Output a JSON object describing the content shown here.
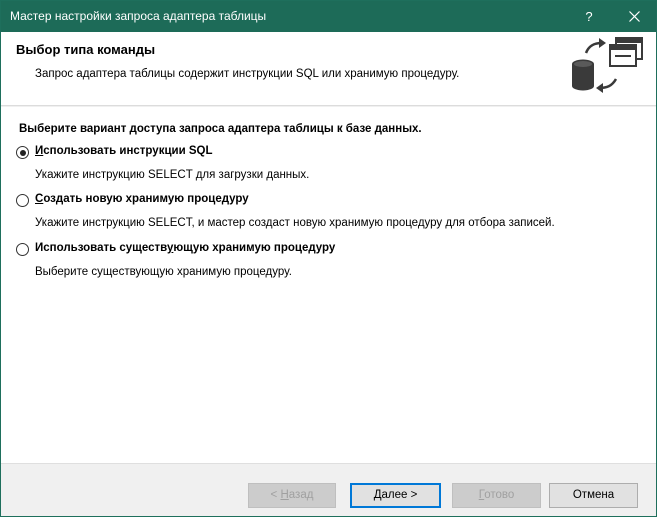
{
  "window": {
    "title": "Мастер настройки запроса адаптера таблицы",
    "help_glyph": "?",
    "accent_color": "#1d6b58"
  },
  "header": {
    "title": "Выбор типа команды",
    "subtitle": "Запрос адаптера таблицы содержит инструкции SQL или хранимую процедуру.",
    "icon": "database-sync-icon"
  },
  "main": {
    "prompt": "Выберите вариант доступа запроса адаптера таблицы к базе данных.",
    "options": [
      {
        "label_before": "",
        "label_accel": "И",
        "label_after": "спользовать инструкции SQL",
        "description": "Укажите инструкцию SELECT для загрузки данных.",
        "selected": true
      },
      {
        "label_before": "",
        "label_accel": "С",
        "label_after": "оздать новую хранимую процедуру",
        "description": "Укажите инструкцию SELECT, и мастер создаст новую хранимую процедуру для отбора записей.",
        "selected": false
      },
      {
        "label_before": "Использовать существ",
        "label_accel": "у",
        "label_after": "ющую хранимую процедуру",
        "description": "Выберите существующую хранимую процедуру.",
        "selected": false
      }
    ]
  },
  "footer": {
    "back": {
      "prefix": "< ",
      "accel": "Н",
      "rest": "азад"
    },
    "next": {
      "prefix": "",
      "accel": "Д",
      "rest": "алее >"
    },
    "finish": {
      "prefix": "",
      "accel": "Г",
      "rest": "отово"
    },
    "cancel": "Отмена"
  }
}
